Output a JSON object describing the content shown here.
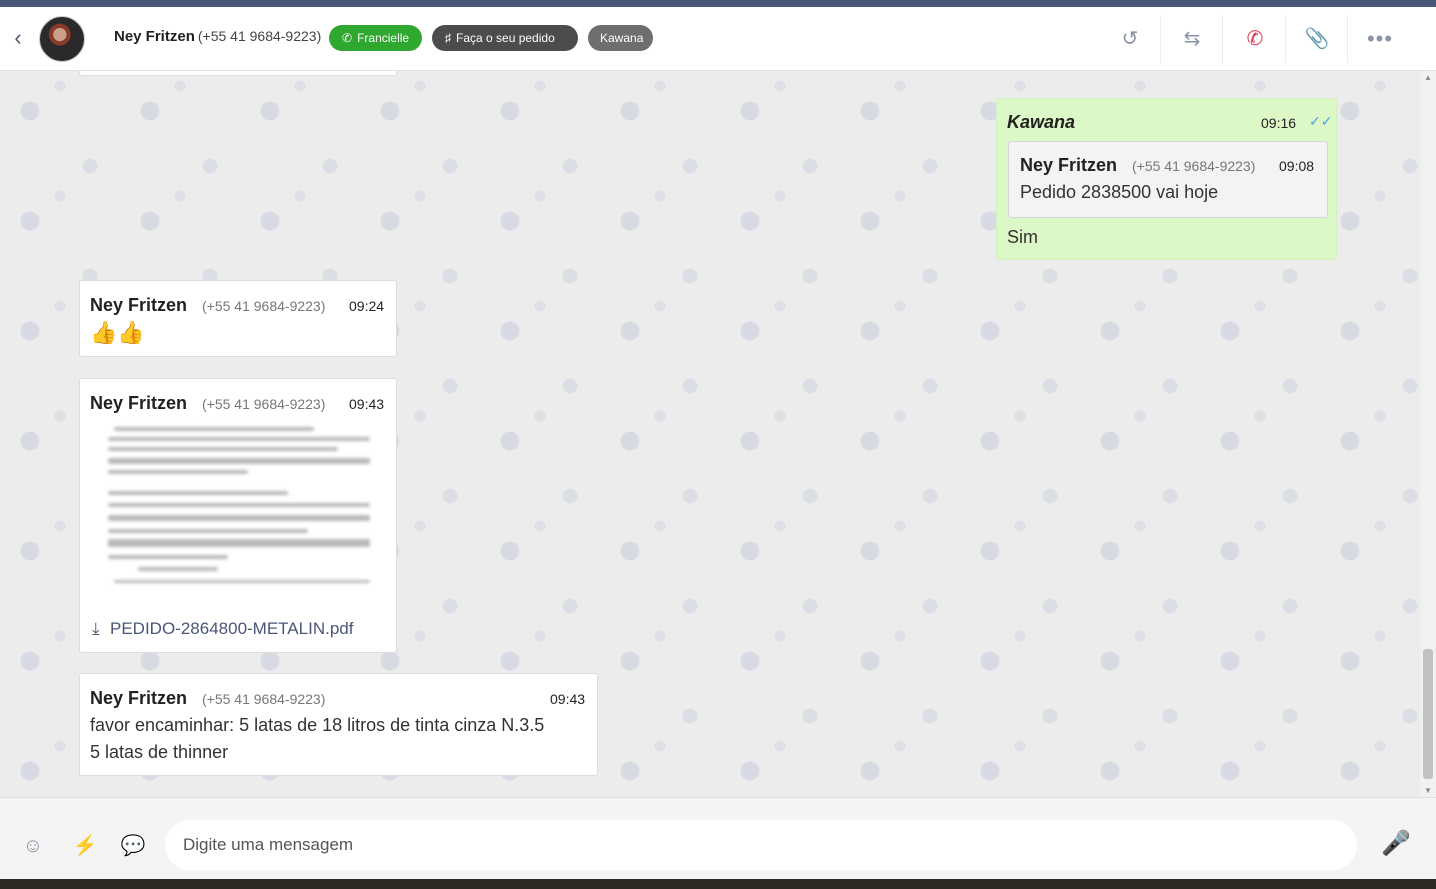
{
  "header": {
    "contact_name": "Ney Fritzen",
    "contact_phone": "(+55 41 9684-9223)",
    "tags": [
      {
        "label": "Francielle",
        "icon": "whatsapp-icon",
        "color": "#2ea82e"
      },
      {
        "label": "Faça o seu pedido",
        "icon": "flow-icon",
        "color": "#4c4c4c"
      },
      {
        "label": "Kawana",
        "color": "#6e6e6e"
      }
    ],
    "actions": [
      "history-icon",
      "transfer-icon",
      "end-chat-icon",
      "attachment-icon",
      "more-icon"
    ]
  },
  "messages": [
    {
      "direction": "outgoing",
      "sender": "Kawana",
      "time": "09:16",
      "status": "read",
      "quote": {
        "sender": "Ney Fritzen",
        "phone": "(+55 41 9684-9223)",
        "time": "09:08",
        "text": "Pedido 2838500 vai hoje"
      },
      "text": "Sim"
    },
    {
      "direction": "incoming",
      "sender": "Ney Fritzen",
      "phone": "(+55 41 9684-9223)",
      "time": "09:24",
      "text": "👍👍"
    },
    {
      "direction": "incoming",
      "sender": "Ney Fritzen",
      "phone": "(+55 41 9684-9223)",
      "time": "09:43",
      "attachment": "PEDIDO-2864800-METALIN.pdf"
    },
    {
      "direction": "incoming",
      "sender": "Ney Fritzen",
      "phone": "(+55 41 9684-9223)",
      "time": "09:43",
      "text_lines": [
        "favor encaminhar: 5 latas de 18 litros de tinta cinza N.3.5",
        "5 latas de thinner"
      ]
    }
  ],
  "composer": {
    "placeholder": "Digite uma mensagem",
    "buttons": [
      "emoji-icon",
      "quick-reply-icon",
      "templates-icon"
    ],
    "mic": "microphone-icon"
  },
  "colors": {
    "accent": "#4a5677",
    "outgoing_bubble": "#dcf8c6",
    "tag_green": "#2ea82e",
    "read_check": "#4fa3e0",
    "end_chat": "#d9364a"
  }
}
